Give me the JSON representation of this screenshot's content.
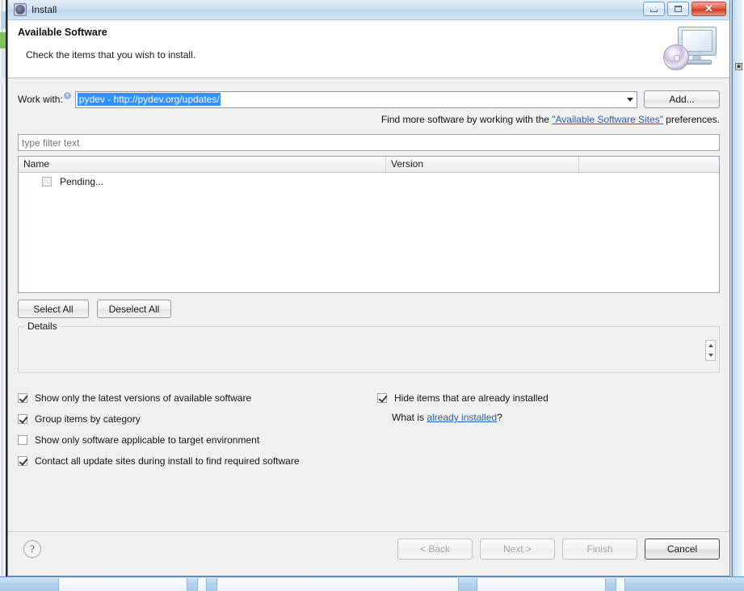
{
  "window": {
    "title": "Install",
    "icon": "install-gear-icon",
    "buttons": {
      "minimize": "minimize-icon",
      "maximize": "maximize-icon",
      "close": "✕"
    }
  },
  "banner": {
    "title": "Available Software",
    "subtitle": "Check the items that you wish to install.",
    "icon": "monitor-cd-icon"
  },
  "work_with": {
    "label": "Work with:",
    "info_glyph": "i",
    "value": "pydev - http://pydev.org/updates/",
    "add_button": "Add...",
    "dropdown_icon": "chevron-down-icon"
  },
  "hint": {
    "before": "Find more software by working with the ",
    "link": "\"Available Software Sites\"",
    "after": " preferences."
  },
  "filter": {
    "placeholder": "type filter text",
    "value": ""
  },
  "table": {
    "columns": [
      "Name",
      "Version",
      ""
    ],
    "rows": [
      {
        "checked": false,
        "disabled": true,
        "name": "Pending...",
        "version": ""
      }
    ]
  },
  "selection_buttons": {
    "select_all": "Select All",
    "deselect_all": "Deselect All"
  },
  "details": {
    "legend": "Details",
    "content": "",
    "spinner_up": "scroll-up-icon",
    "spinner_down": "scroll-down-icon"
  },
  "options": {
    "left": [
      {
        "label": "Show only the latest versions of available software",
        "checked": true
      },
      {
        "label": "Group items by category",
        "checked": true
      },
      {
        "label": "Show only software applicable to target environment",
        "checked": false
      },
      {
        "label": "Contact all update sites during install to find required software",
        "checked": true
      }
    ],
    "right": [
      {
        "label": "Hide items that are already installed",
        "checked": true
      }
    ],
    "what_is": {
      "before": "What is ",
      "link": "already installed",
      "after": "?"
    }
  },
  "footer": {
    "help": "?",
    "back": "< Back",
    "next": "Next >",
    "finish": "Finish",
    "cancel": "Cancel"
  },
  "colors": {
    "selection_blue": "#3390ff",
    "link_blue": "#2a5db0",
    "title_bar": "#cfe1f2",
    "close_red": "#cf3b26",
    "dialog_bg": "#f0f0f0"
  }
}
